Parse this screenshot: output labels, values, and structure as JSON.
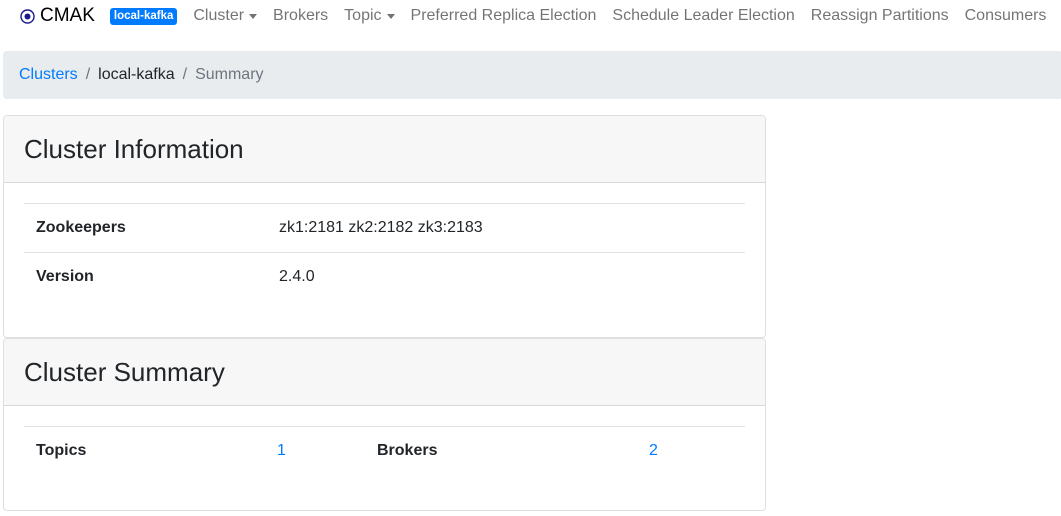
{
  "navbar": {
    "brand": "CMAK",
    "cluster_badge": "local-kafka",
    "items": [
      {
        "label": "Cluster",
        "dropdown": true
      },
      {
        "label": "Brokers",
        "dropdown": false
      },
      {
        "label": "Topic",
        "dropdown": true
      },
      {
        "label": "Preferred Replica Election",
        "dropdown": false
      },
      {
        "label": "Schedule Leader Election",
        "dropdown": false
      },
      {
        "label": "Reassign Partitions",
        "dropdown": false
      },
      {
        "label": "Consumers",
        "dropdown": false
      }
    ]
  },
  "breadcrumb": {
    "root": "Clusters",
    "separator": "/",
    "cluster": "local-kafka",
    "current": "Summary"
  },
  "cluster_info": {
    "title": "Cluster Information",
    "rows": [
      {
        "label": "Zookeepers",
        "value": "zk1:2181 zk2:2182 zk3:2183"
      },
      {
        "label": "Version",
        "value": "2.4.0"
      }
    ]
  },
  "cluster_summary": {
    "title": "Cluster Summary",
    "topics_label": "Topics",
    "topics_value": "1",
    "brokers_label": "Brokers",
    "brokers_value": "2"
  },
  "colors": {
    "accent": "#007bff",
    "breadcrumb_bg": "#e9ecef",
    "card_header_bg": "#f7f7f7"
  }
}
